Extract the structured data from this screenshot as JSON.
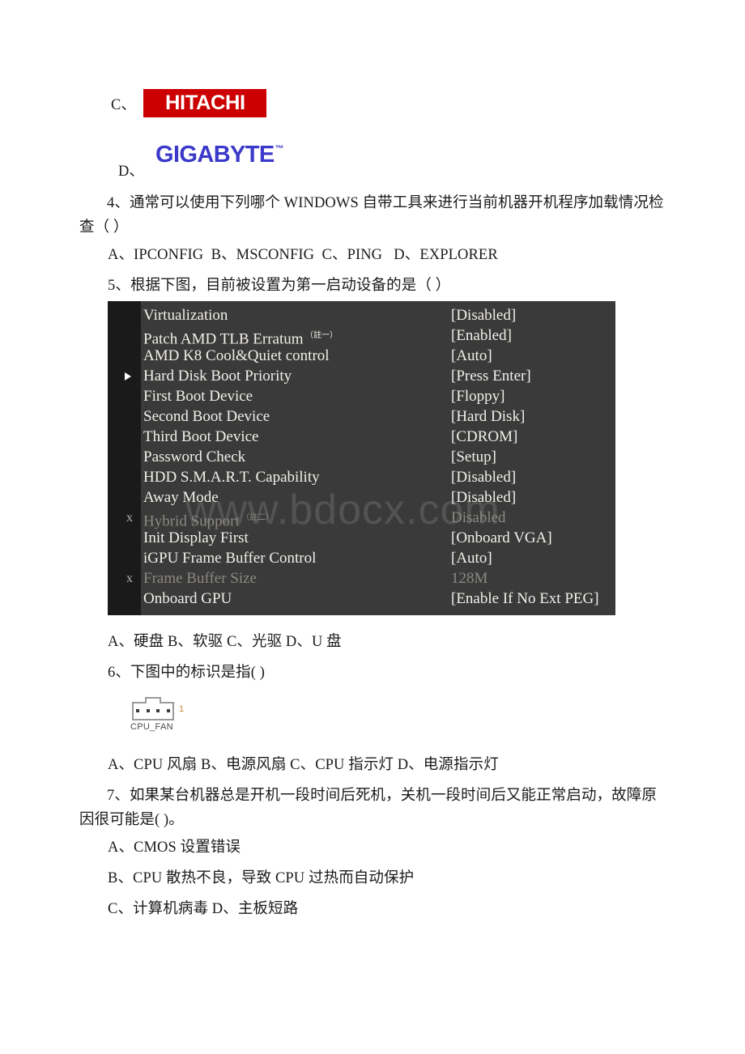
{
  "document": {
    "options_cd": {
      "c_label": "C、",
      "d_label": "D、",
      "hitachi_logo_text": "HITACHI",
      "hitachi_color": "#cc0000",
      "gigabyte_logo_text": "GIGABYTE",
      "gigabyte_tm": "™",
      "gigabyte_color": "#3b39c9"
    },
    "question4": {
      "stem": "4、通常可以使用下列哪个 WINDOWS 自带工具来进行当前机器开机程序加载情况检查（ ）",
      "answers": "A、IPCONFIG  B、MSCONFIG  C、PING   D、EXPLORER"
    },
    "question5": {
      "stem": "5、根据下图，目前被设置为第一启动设备的是（ ）",
      "answers": "A、硬盘 B、软驱 C、光驱 D、U 盘"
    },
    "question6": {
      "stem": "6、下图中的标识是指( )",
      "answers": "A、CPU 风扇 B、电源风扇 C、CPU 指示灯 D、电源指示灯"
    },
    "question7": {
      "stem": "7、如果某台机器总是开机一段时间后死机，关机一段时间后又能正常启动，故障原因很可能是( )。",
      "answer_a": "A、CMOS 设置错误",
      "answer_b": "B、CPU 散热不良，导致 CPU 过热而自动保护",
      "answer_c": "C、计算机病毒 D、主板短路"
    }
  },
  "bios_screen": {
    "watermark": "www.bdocx.com",
    "background_color": "#3a3a3a",
    "text_color": "#f2efe9",
    "dim_text_color": "#8c8880",
    "rows": [
      {
        "marker": "",
        "label": "Virtualization",
        "sup": "",
        "value": "[Disabled]",
        "dim": false,
        "selected": false
      },
      {
        "marker": "",
        "label": "Patch AMD TLB Erratum",
        "sup": "（註一）",
        "value": "[Enabled]",
        "dim": false,
        "selected": false
      },
      {
        "marker": "",
        "label": "AMD K8 Cool&Quiet control",
        "sup": "",
        "value": "[Auto]",
        "dim": false,
        "selected": false
      },
      {
        "marker": "▶",
        "label": "Hard Disk Boot Priority",
        "sup": "",
        "value": "[Press Enter]",
        "dim": false,
        "selected": true
      },
      {
        "marker": "",
        "label": "First Boot Device",
        "sup": "",
        "value": "[Floppy]",
        "dim": false,
        "selected": false
      },
      {
        "marker": "",
        "label": "Second Boot Device",
        "sup": "",
        "value": "[Hard Disk]",
        "dim": false,
        "selected": false
      },
      {
        "marker": "",
        "label": "Third Boot Device",
        "sup": "",
        "value": "[CDROM]",
        "dim": false,
        "selected": false
      },
      {
        "marker": "",
        "label": "Password Check",
        "sup": "",
        "value": "[Setup]",
        "dim": false,
        "selected": false
      },
      {
        "marker": "",
        "label": "HDD S.M.A.R.T. Capability",
        "sup": "",
        "value": "[Disabled]",
        "dim": false,
        "selected": false
      },
      {
        "marker": "",
        "label": "Away Mode",
        "sup": "",
        "value": "[Disabled]",
        "dim": false,
        "selected": false
      },
      {
        "marker": "x",
        "label": "Hybrid Support",
        "sup": "（註二）",
        "value": "Disabled",
        "dim": true,
        "selected": false
      },
      {
        "marker": "",
        "label": "Init Display First",
        "sup": "",
        "value": "[Onboard VGA]",
        "dim": false,
        "selected": false
      },
      {
        "marker": "",
        "label": "iGPU Frame Buffer Control",
        "sup": "",
        "value": "[Auto]",
        "dim": false,
        "selected": false
      },
      {
        "marker": "x",
        "label": "Frame Buffer Size",
        "sup": "",
        "value": "128M",
        "dim": true,
        "selected": false
      },
      {
        "marker": "",
        "label": "Onboard GPU",
        "sup": "",
        "value": "[Enable If No Ext PEG]",
        "dim": false,
        "selected": false
      }
    ]
  },
  "cpu_fan_figure": {
    "caption": "CPU_FAN",
    "pin_label": "1",
    "pin_count": 4
  }
}
